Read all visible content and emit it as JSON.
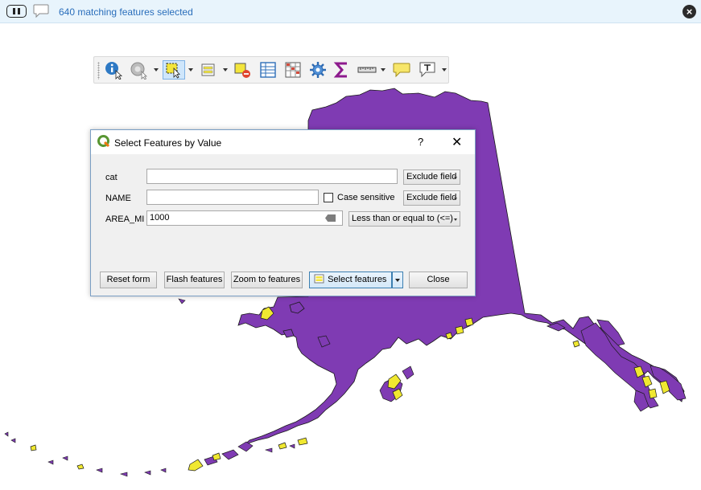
{
  "message_bar": {
    "message": "640 matching features selected"
  },
  "toolbar": {
    "tools": [
      {
        "name": "identify-features-icon"
      },
      {
        "name": "run-action-icon"
      },
      {
        "name": "select-features-icon"
      },
      {
        "name": "select-by-value-icon"
      },
      {
        "name": "deselect-features-icon"
      },
      {
        "name": "attribute-table-icon"
      },
      {
        "name": "field-calculator-icon"
      },
      {
        "name": "toolbox-gear-icon"
      },
      {
        "name": "statistical-summary-icon"
      },
      {
        "name": "measure-line-icon"
      },
      {
        "name": "map-tips-icon"
      },
      {
        "name": "text-annotation-icon"
      }
    ]
  },
  "dialog": {
    "title": "Select Features by Value",
    "help_label": "?",
    "close_label": "✕",
    "rows": [
      {
        "label": "cat",
        "value": "",
        "option": "Exclude field"
      },
      {
        "label": "NAME",
        "value": "",
        "case_sensitive_label": "Case sensitive",
        "option": "Exclude field"
      },
      {
        "label": "AREA_MI",
        "value": "1000",
        "option": "Less than or equal to (<=)"
      }
    ],
    "buttons": {
      "reset": "Reset form",
      "flash": "Flash features",
      "zoom": "Zoom to features",
      "select": "Select features",
      "close": "Close"
    }
  },
  "colors": {
    "map_fill": "#7f3bb3",
    "selected_fill": "#f0e830",
    "message_text": "#2a6ebb",
    "message_bar_bg": "#e8f4fc"
  }
}
